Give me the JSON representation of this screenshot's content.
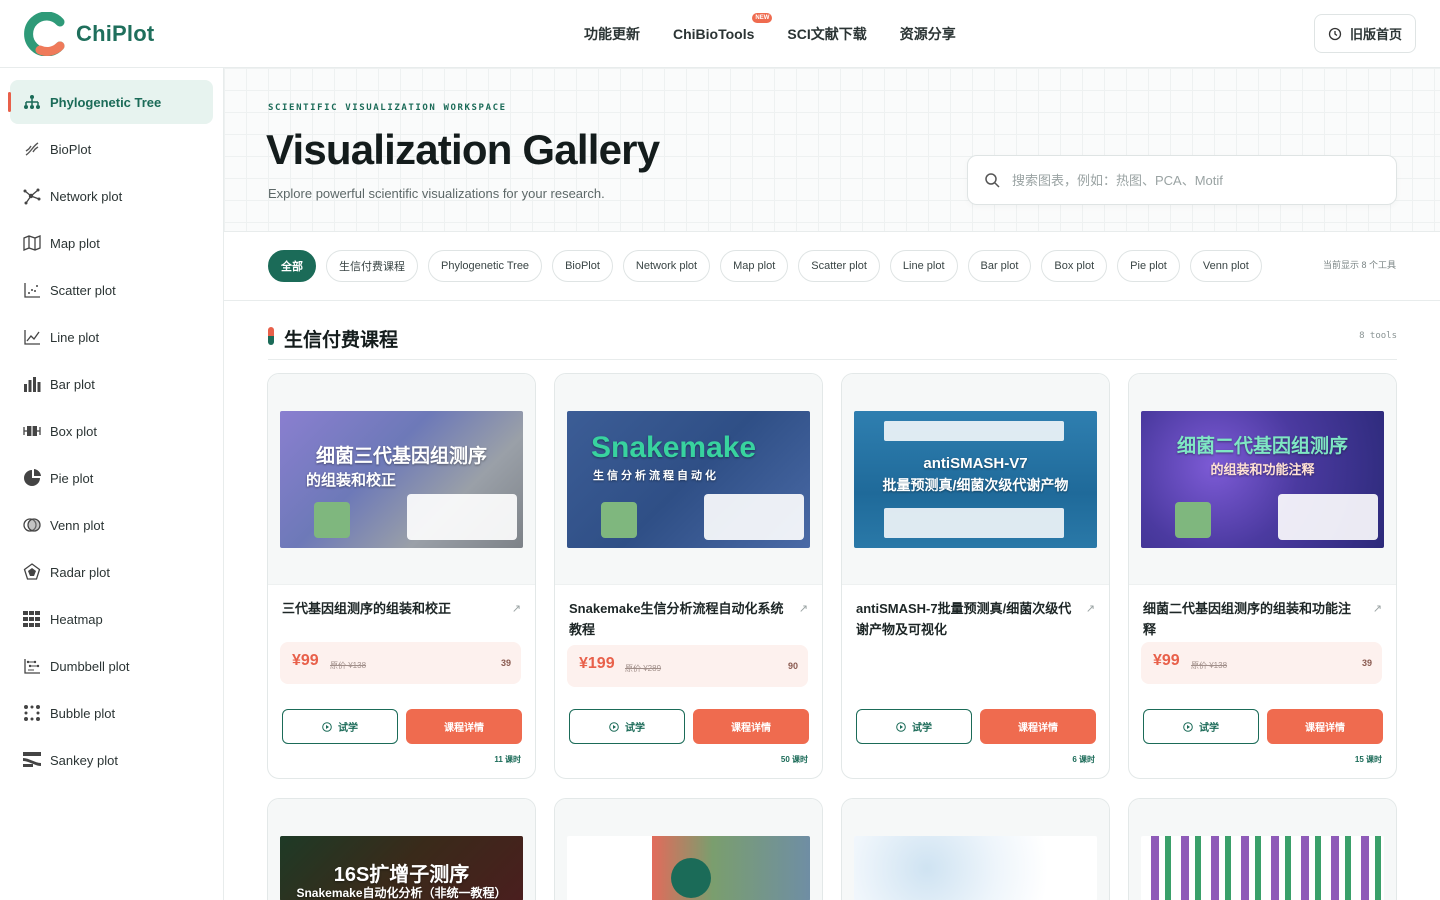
{
  "header": {
    "brand": "ChiPlot",
    "nav": [
      {
        "label": "功能更新"
      },
      {
        "label": "ChiBioTools",
        "badge": "NEW"
      },
      {
        "label": "SCI文献下载"
      },
      {
        "label": "资源分享"
      }
    ],
    "old_home_label": "旧版首页"
  },
  "sidebar": {
    "items": [
      {
        "label": "Phylogenetic Tree",
        "icon": "tree-icon"
      },
      {
        "label": "BioPlot",
        "icon": "dna-icon"
      },
      {
        "label": "Network plot",
        "icon": "network-icon"
      },
      {
        "label": "Map plot",
        "icon": "map-icon"
      },
      {
        "label": "Scatter plot",
        "icon": "scatter-icon"
      },
      {
        "label": "Line plot",
        "icon": "line-chart-icon"
      },
      {
        "label": "Bar plot",
        "icon": "bar-chart-icon"
      },
      {
        "label": "Box plot",
        "icon": "box-plot-icon"
      },
      {
        "label": "Pie plot",
        "icon": "pie-chart-icon"
      },
      {
        "label": "Venn plot",
        "icon": "venn-icon"
      },
      {
        "label": "Radar plot",
        "icon": "radar-icon"
      },
      {
        "label": "Heatmap",
        "icon": "heatmap-icon"
      },
      {
        "label": "Dumbbell plot",
        "icon": "dumbbell-icon"
      },
      {
        "label": "Bubble plot",
        "icon": "bubble-icon"
      },
      {
        "label": "Sankey plot",
        "icon": "sankey-icon"
      }
    ]
  },
  "hero": {
    "eyebrow": "SCIENTIFIC VISUALIZATION WORKSPACE",
    "title": "Visualization Gallery",
    "subtitle": "Explore powerful scientific visualizations for your research.",
    "search_placeholder": "搜索图表，例如：热图、PCA、Motif"
  },
  "filters": {
    "chips": [
      "全部",
      "生信付费课程",
      "Phylogenetic Tree",
      "BioPlot",
      "Network plot",
      "Map plot",
      "Scatter plot",
      "Line plot",
      "Bar plot",
      "Box plot",
      "Pie plot",
      "Venn plot"
    ],
    "count_text": "当前显示 8 个工具"
  },
  "section": {
    "title": "生信付费课程",
    "tools_count": "8 tools"
  },
  "cards": [
    {
      "title": "三代基因组测序的组装和校正",
      "price": "¥99",
      "original": "原价 ¥138",
      "sales": "39",
      "try_label": "试学",
      "detail_label": "课程详情",
      "lessons": "11 课时",
      "thumb_title": "细菌三代基因组测序",
      "thumb_sub": "的组装和校正"
    },
    {
      "title": "Snakemake生信分析流程自动化系统教程",
      "price": "¥199",
      "original": "原价 ¥289",
      "sales": "90",
      "try_label": "试学",
      "detail_label": "课程详情",
      "lessons": "50 课时",
      "thumb_title": "Snakemake",
      "thumb_sub": "生信分析流程自动化"
    },
    {
      "title": "antiSMASH-7批量预测真/细菌次级代谢产物及可视化",
      "try_label": "试学",
      "detail_label": "课程详情",
      "lessons": "6 课时",
      "thumb_title": "antiSMASH-V7",
      "thumb_sub": "批量预测真/细菌次级代谢产物"
    },
    {
      "title": "细菌二代基因组测序的组装和功能注释",
      "price": "¥99",
      "original": "原价 ¥138",
      "sales": "39",
      "try_label": "试学",
      "detail_label": "课程详情",
      "lessons": "15 课时",
      "thumb_title": "细菌二代基因组测序",
      "thumb_sub": "的组装和功能注释"
    }
  ],
  "cards_row2": [
    {
      "thumb_title": "16S扩增子测序",
      "thumb_sub": "Snakemake自动化分析（非统一教程）"
    }
  ],
  "colors": {
    "brand": "#1b6b58",
    "accent": "#ef6b4f"
  }
}
